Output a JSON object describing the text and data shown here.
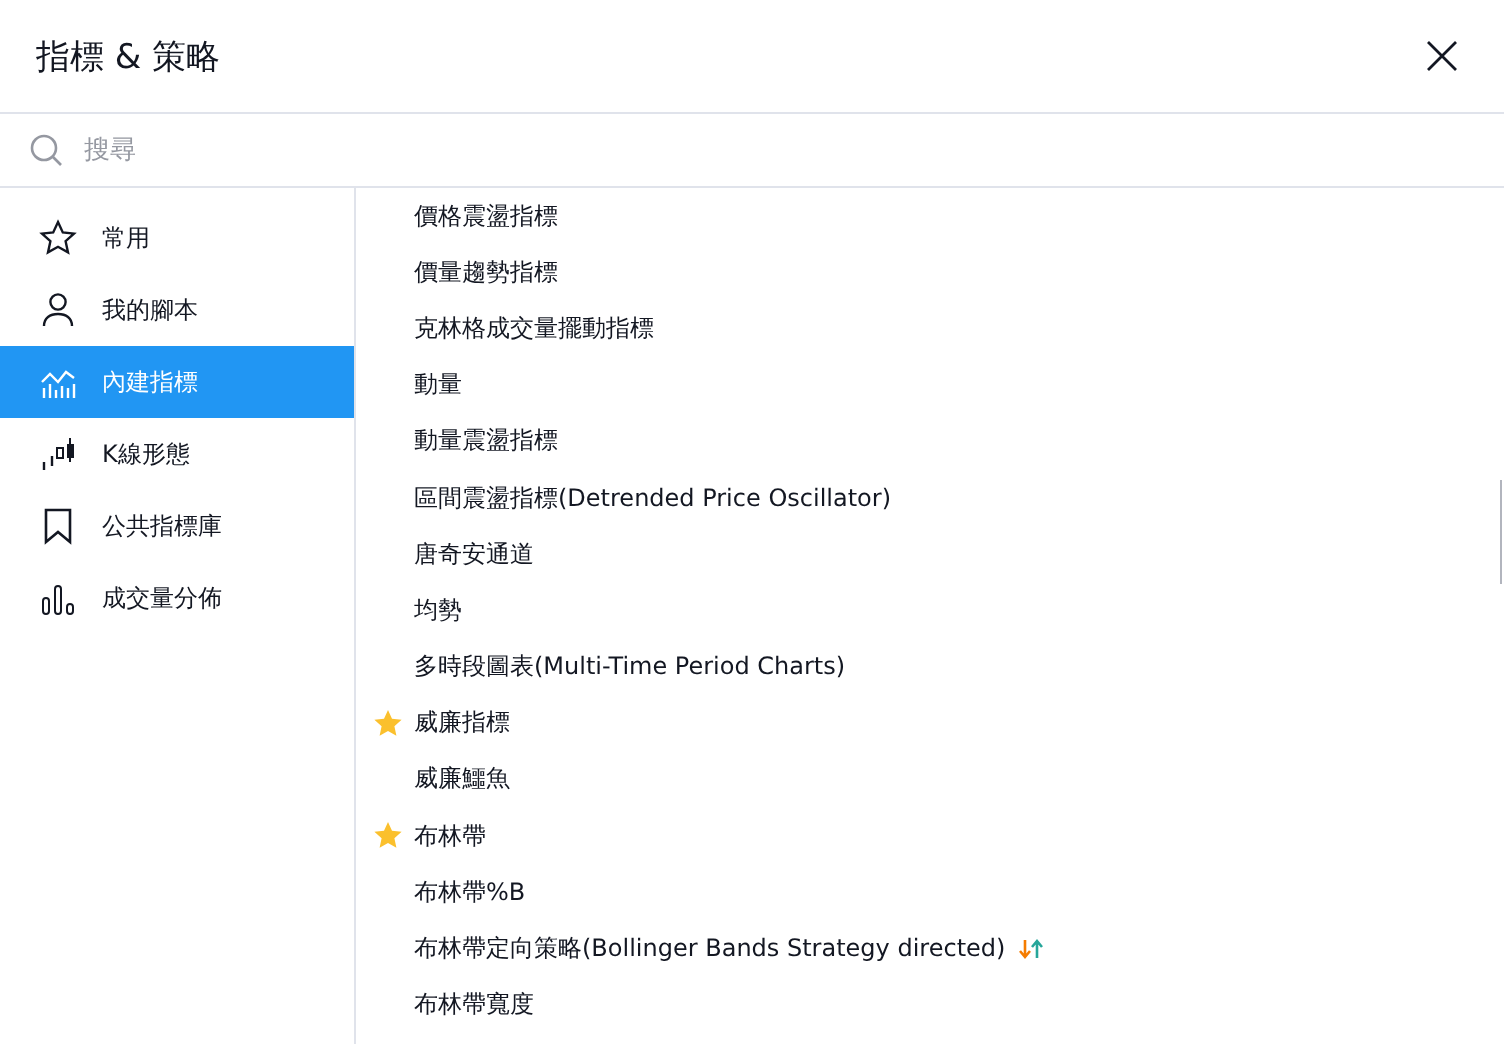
{
  "window": {
    "title": "指標 & 策略"
  },
  "search": {
    "placeholder": "搜尋"
  },
  "sidebar": {
    "items": [
      {
        "label": "常用",
        "kind": "star",
        "selected": false
      },
      {
        "label": "我的腳本",
        "kind": "user",
        "selected": false
      },
      {
        "label": "內建指標",
        "kind": "chart",
        "selected": true
      },
      {
        "label": "K線形態",
        "kind": "candles",
        "selected": false
      },
      {
        "label": "公共指標庫",
        "kind": "bookmark",
        "selected": false
      },
      {
        "label": "成交量分佈",
        "kind": "bars",
        "selected": false
      }
    ]
  },
  "indicators": [
    {
      "label": "價格震盪指標",
      "favorite": false,
      "strategy": false
    },
    {
      "label": "價量趨勢指標",
      "favorite": false,
      "strategy": false
    },
    {
      "label": "克林格成交量擺動指標",
      "favorite": false,
      "strategy": false
    },
    {
      "label": "動量",
      "favorite": false,
      "strategy": false
    },
    {
      "label": "動量震盪指標",
      "favorite": false,
      "strategy": false
    },
    {
      "label": "區間震盪指標(Detrended Price Oscillator)",
      "favorite": false,
      "strategy": false
    },
    {
      "label": "唐奇安通道",
      "favorite": false,
      "strategy": false
    },
    {
      "label": "均勢",
      "favorite": false,
      "strategy": false
    },
    {
      "label": "多時段圖表(Multi-Time Period Charts)",
      "favorite": false,
      "strategy": false
    },
    {
      "label": "威廉指標",
      "favorite": true,
      "strategy": false
    },
    {
      "label": "威廉鱷魚",
      "favorite": false,
      "strategy": false
    },
    {
      "label": "布林帶",
      "favorite": true,
      "strategy": false
    },
    {
      "label": "布林帶%B",
      "favorite": false,
      "strategy": false
    },
    {
      "label": "布林帶定向策略(Bollinger Bands Strategy directed)",
      "favorite": false,
      "strategy": true
    },
    {
      "label": "布林帶寬度",
      "favorite": false,
      "strategy": false
    }
  ]
}
